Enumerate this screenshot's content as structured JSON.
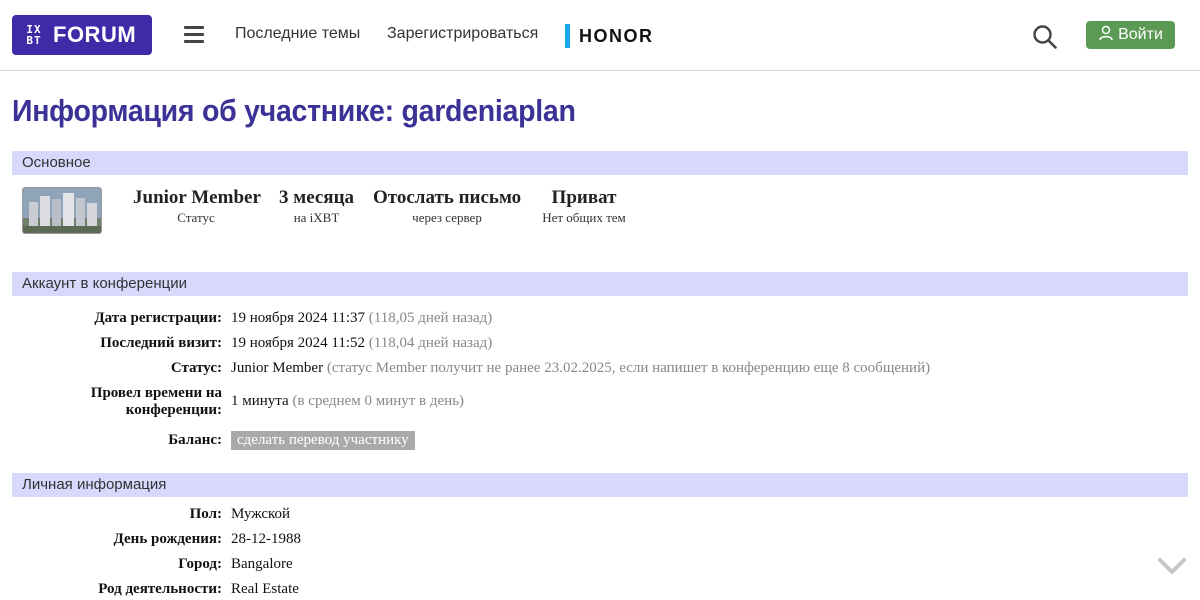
{
  "header": {
    "logo_mark_top": "IX",
    "logo_mark_bottom": "BT",
    "logo_text": "FORUM",
    "nav_latest": "Последние темы",
    "nav_register": "Зарегистрироваться",
    "brand": "HONOR",
    "login_label": "Войти",
    "colors": {
      "logo_bg": "#3f2aa8",
      "login_bg": "#5b9a55",
      "brand_bar": "#1aa7e8"
    }
  },
  "page_title": "Информация об участнике: gardeniaplan",
  "sections": {
    "basic": "Основное",
    "account": "Аккаунт в конференции",
    "personal": "Личная информация"
  },
  "basic": {
    "stats": [
      {
        "main": "Junior Member",
        "sub": "Статус"
      },
      {
        "main": "3 месяца",
        "sub": "на iXBT"
      },
      {
        "main": "Отослать письмо",
        "sub": "через сервер"
      },
      {
        "main": "Приват",
        "sub": "Нет общих тем"
      }
    ]
  },
  "account": {
    "reg_label": "Дата регистрации:",
    "reg_value": "19 ноября 2024 11:37",
    "reg_note": "(118,05 дней назад)",
    "visit_label": "Последний визит:",
    "visit_value": "19 ноября 2024 11:52",
    "visit_note": "(118,04 дней назад)",
    "status_label": "Статус:",
    "status_value": "Junior Member",
    "status_note": "(статус Member получит не ранее 23.02.2025, если напишет в конференцию еще 8 сообщений)",
    "time_label_1": "Провел времени на",
    "time_label_2": "конференции:",
    "time_value": "1 минута",
    "time_note": "(в среднем 0 минут в день)",
    "balance_label": "Баланс:",
    "balance_button": "сделать перевод участнику"
  },
  "personal": {
    "gender_label": "Пол:",
    "gender_value": "Мужской",
    "birthday_label": "День рождения:",
    "birthday_value": "28-12-1988",
    "city_label": "Город:",
    "city_value": "Bangalore",
    "occupation_label": "Род деятельности:",
    "occupation_value": "Real Estate"
  },
  "icons": {
    "menu": "hamburger-icon",
    "search": "search-icon",
    "user": "user-icon",
    "scroll": "chevron-down-icon"
  }
}
